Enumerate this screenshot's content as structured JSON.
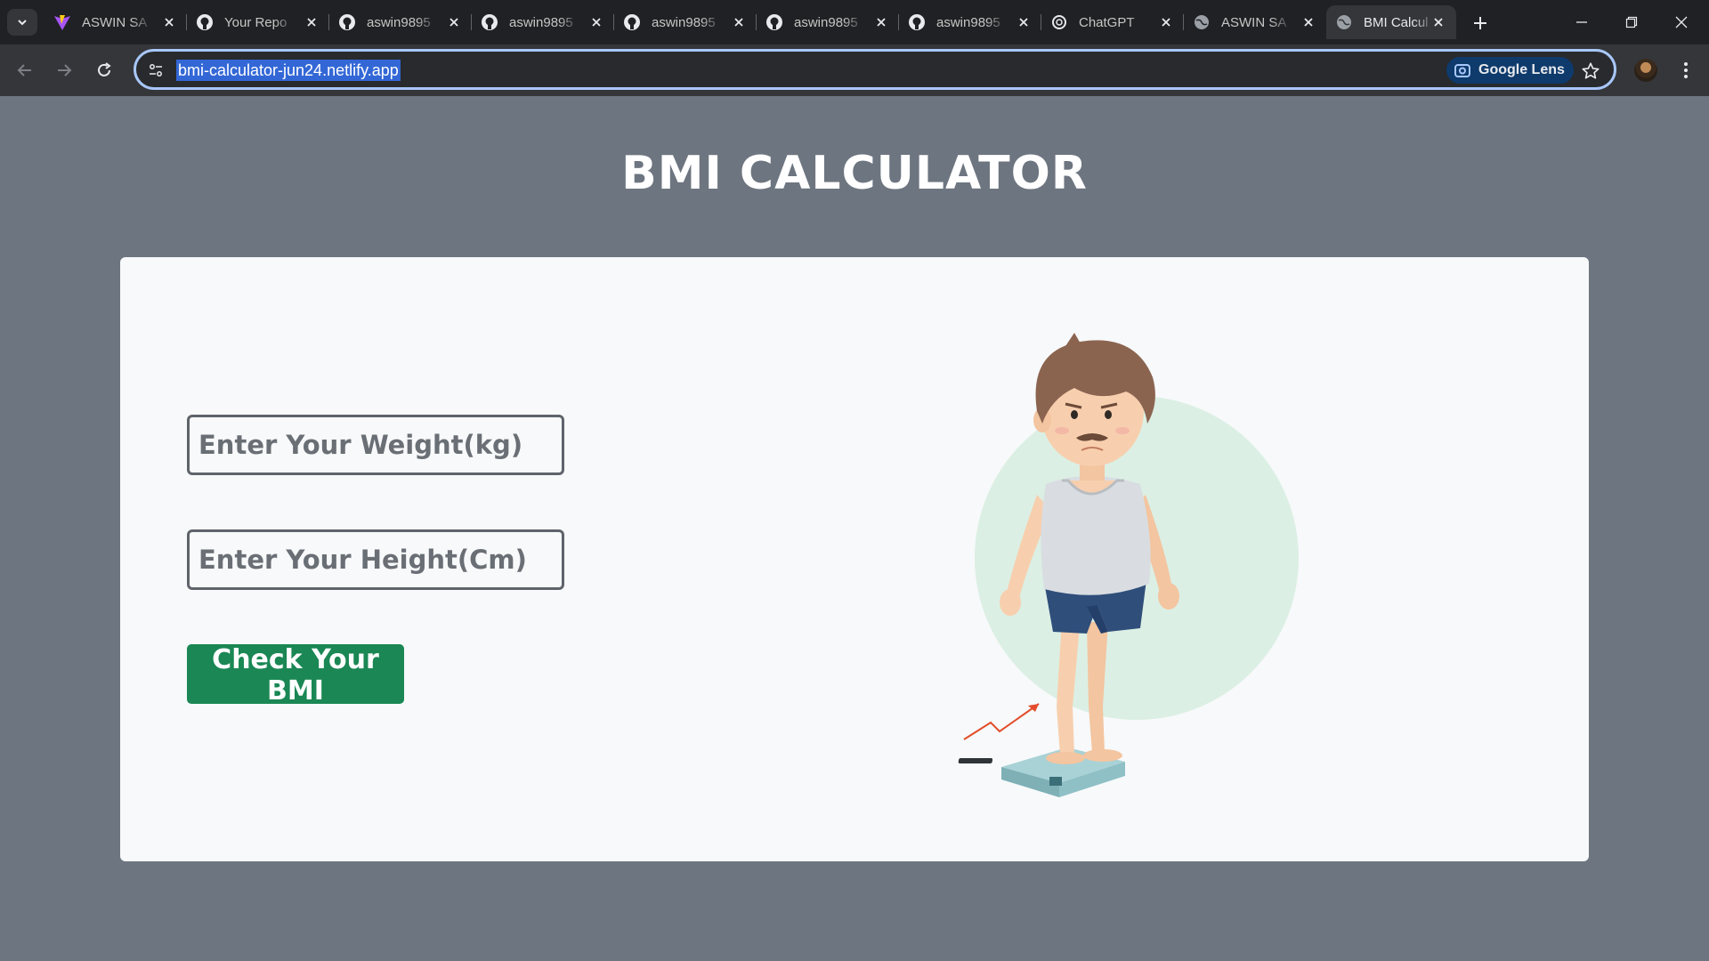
{
  "browser": {
    "tabs": [
      {
        "title": "ASWIN SA",
        "icon": "vite-icon"
      },
      {
        "title": "Your Repo",
        "icon": "github-icon"
      },
      {
        "title": "aswin9895",
        "icon": "github-icon"
      },
      {
        "title": "aswin9895",
        "icon": "github-icon"
      },
      {
        "title": "aswin9895",
        "icon": "github-icon"
      },
      {
        "title": "aswin9895",
        "icon": "github-icon"
      },
      {
        "title": "aswin9895",
        "icon": "github-icon"
      },
      {
        "title": "ChatGPT",
        "icon": "chatgpt-icon"
      },
      {
        "title": "ASWIN SA",
        "icon": "globe-icon"
      },
      {
        "title": "BMI Calcul",
        "icon": "globe-icon",
        "active": true
      }
    ],
    "url": "bmi-calculator-jun24.netlify.app",
    "lens_label": "Google Lens"
  },
  "page": {
    "title": "BMI CALCULATOR",
    "weight_placeholder": "Enter Your Weight(kg)",
    "height_placeholder": "Enter Your Height(Cm)",
    "check_button": "Check Your BMI"
  },
  "colors": {
    "page_background": "#6d7580",
    "card_background": "#f7f9fa",
    "button_green": "#1a8754",
    "tab_strip": "#202124",
    "toolbar": "#35363a",
    "accent_blue": "#a8c7fa"
  }
}
